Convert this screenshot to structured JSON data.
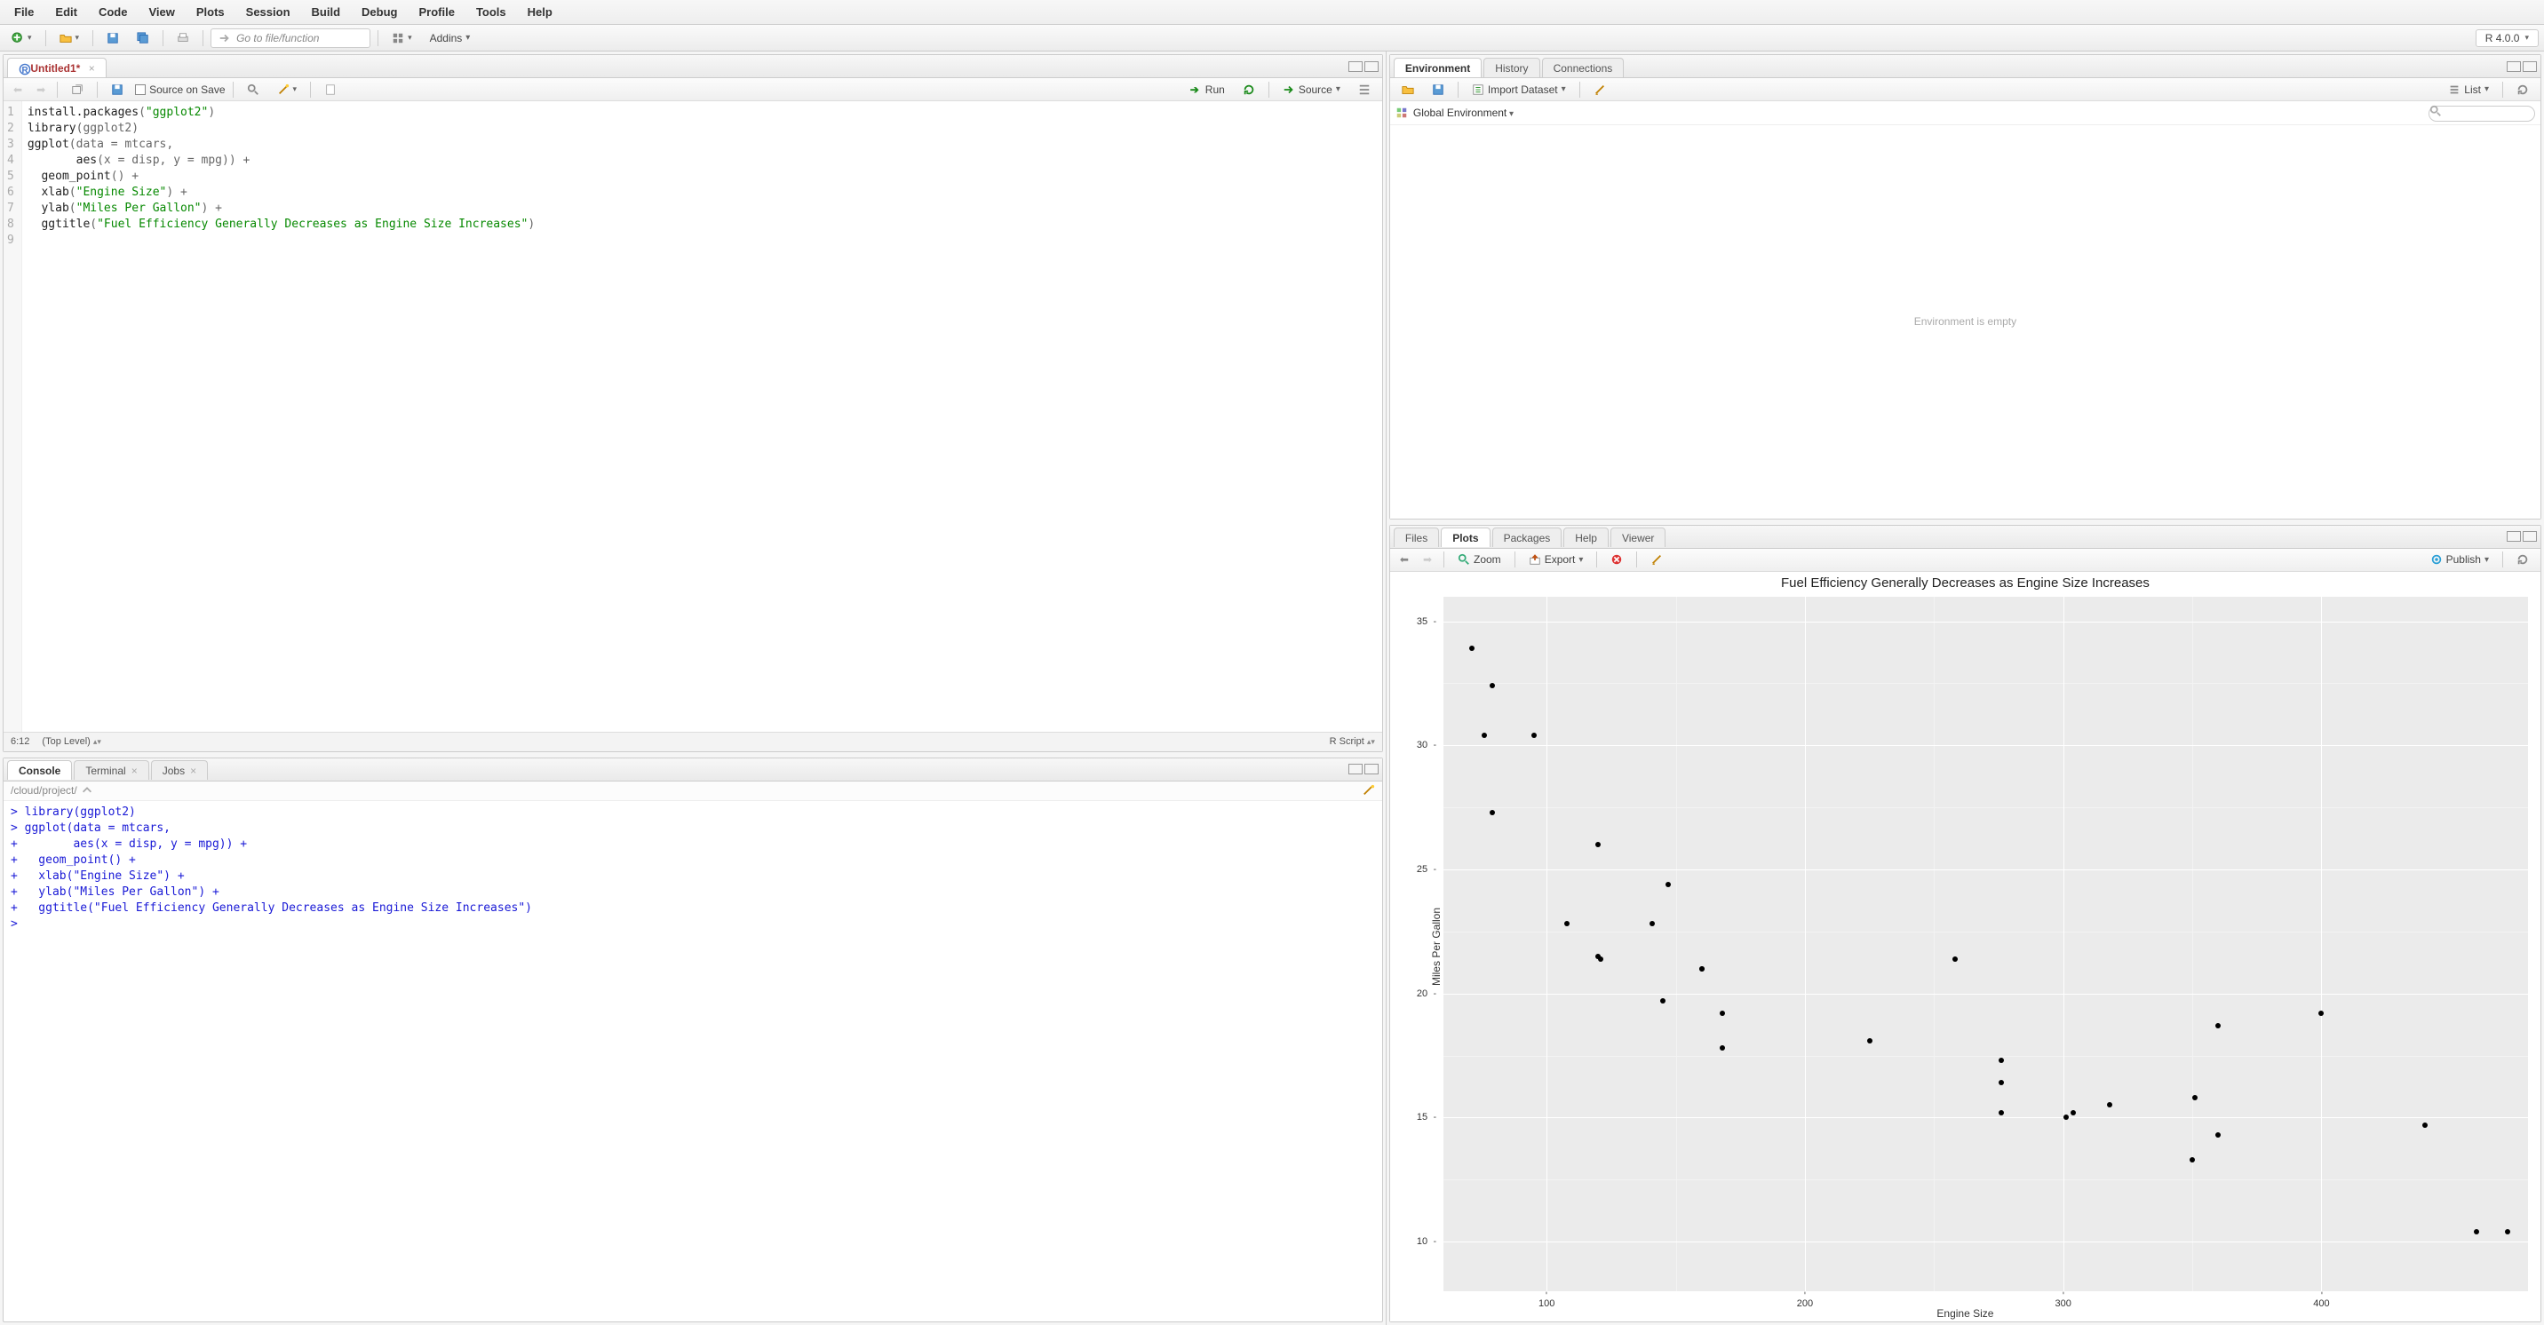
{
  "menus": [
    "File",
    "Edit",
    "Code",
    "View",
    "Plots",
    "Session",
    "Build",
    "Debug",
    "Profile",
    "Tools",
    "Help"
  ],
  "topbar": {
    "goto_placeholder": "Go to file/function",
    "addins_label": "Addins",
    "r_version": "R 4.0.0"
  },
  "source": {
    "tab_label": "Untitled1*",
    "save_on_source_label": "Source on Save",
    "run_label": "Run",
    "source_btn_label": "Source",
    "cursor_pos": "6:12",
    "scope_label": "(Top Level)",
    "lang_label": "R Script",
    "line_numbers": [
      "1",
      "2",
      "3",
      "4",
      "5",
      "6",
      "7",
      "8",
      "9"
    ],
    "code_lines": [
      [
        {
          "t": "install.packages",
          "c": "tk-fn"
        },
        {
          "t": "(",
          "c": "tk-op"
        },
        {
          "t": "\"ggplot2\"",
          "c": "tk-str"
        },
        {
          "t": ")",
          "c": "tk-op"
        }
      ],
      [
        {
          "t": "library",
          "c": "tk-fn"
        },
        {
          "t": "(ggplot2)",
          "c": "tk-op"
        }
      ],
      [
        {
          "t": "ggplot",
          "c": "tk-fn"
        },
        {
          "t": "(data = mtcars,",
          "c": "tk-op"
        }
      ],
      [
        {
          "t": "       aes",
          "c": "tk-fn"
        },
        {
          "t": "(x = disp, y = mpg)) +",
          "c": "tk-op"
        }
      ],
      [
        {
          "t": "  geom_point",
          "c": "tk-fn"
        },
        {
          "t": "() +",
          "c": "tk-op"
        }
      ],
      [
        {
          "t": "  xlab",
          "c": "tk-fn"
        },
        {
          "t": "(",
          "c": "tk-op"
        },
        {
          "t": "\"Engine Size\"",
          "c": "tk-str"
        },
        {
          "t": ") +",
          "c": "tk-op"
        }
      ],
      [
        {
          "t": "  ylab",
          "c": "tk-fn"
        },
        {
          "t": "(",
          "c": "tk-op"
        },
        {
          "t": "\"Miles Per Gallon\"",
          "c": "tk-str"
        },
        {
          "t": ") +",
          "c": "tk-op"
        }
      ],
      [
        {
          "t": "  ggtitle",
          "c": "tk-fn"
        },
        {
          "t": "(",
          "c": "tk-op"
        },
        {
          "t": "\"Fuel Efficiency Generally Decreases as Engine Size Increases\"",
          "c": "tk-str"
        },
        {
          "t": ")",
          "c": "tk-op"
        }
      ],
      [
        {
          "t": "",
          "c": ""
        }
      ]
    ]
  },
  "console": {
    "tabs": [
      "Console",
      "Terminal",
      "Jobs"
    ],
    "active_tab": 0,
    "path": "/cloud/project/",
    "lines": [
      "> library(ggplot2)",
      "> ggplot(data = mtcars,",
      "+        aes(x = disp, y = mpg)) +",
      "+   geom_point() +",
      "+   xlab(\"Engine Size\") +",
      "+   ylab(\"Miles Per Gallon\") +",
      "+   ggtitle(\"Fuel Efficiency Generally Decreases as Engine Size Increases\")",
      "> "
    ]
  },
  "environment": {
    "tabs": [
      "Environment",
      "History",
      "Connections"
    ],
    "active_tab": 0,
    "import_label": "Import Dataset",
    "list_label": "List",
    "scope_label": "Global Environment",
    "search_placeholder": "",
    "empty_msg": "Environment is empty"
  },
  "plots": {
    "tabs": [
      "Files",
      "Plots",
      "Packages",
      "Help",
      "Viewer"
    ],
    "active_tab": 1,
    "zoom_label": "Zoom",
    "export_label": "Export",
    "publish_label": "Publish"
  },
  "chart_data": {
    "type": "scatter",
    "title": "Fuel Efficiency Generally Decreases as Engine Size Increases",
    "xlabel": "Engine Size",
    "ylabel": "Miles Per Gallon",
    "xlim": [
      60,
      480
    ],
    "ylim": [
      8,
      36
    ],
    "xticks": [
      100,
      200,
      300,
      400
    ],
    "yticks": [
      10,
      15,
      20,
      25,
      30,
      35
    ],
    "points": [
      {
        "x": 160,
        "y": 21.0
      },
      {
        "x": 160,
        "y": 21.0
      },
      {
        "x": 108,
        "y": 22.8
      },
      {
        "x": 258,
        "y": 21.4
      },
      {
        "x": 360,
        "y": 18.7
      },
      {
        "x": 225,
        "y": 18.1
      },
      {
        "x": 360,
        "y": 14.3
      },
      {
        "x": 147,
        "y": 24.4
      },
      {
        "x": 141,
        "y": 22.8
      },
      {
        "x": 168,
        "y": 19.2
      },
      {
        "x": 168,
        "y": 17.8
      },
      {
        "x": 276,
        "y": 16.4
      },
      {
        "x": 276,
        "y": 17.3
      },
      {
        "x": 276,
        "y": 15.2
      },
      {
        "x": 472,
        "y": 10.4
      },
      {
        "x": 460,
        "y": 10.4
      },
      {
        "x": 440,
        "y": 14.7
      },
      {
        "x": 79,
        "y": 32.4
      },
      {
        "x": 76,
        "y": 30.4
      },
      {
        "x": 71,
        "y": 33.9
      },
      {
        "x": 120,
        "y": 21.5
      },
      {
        "x": 318,
        "y": 15.5
      },
      {
        "x": 304,
        "y": 15.2
      },
      {
        "x": 350,
        "y": 13.3
      },
      {
        "x": 400,
        "y": 19.2
      },
      {
        "x": 79,
        "y": 27.3
      },
      {
        "x": 120,
        "y": 26.0
      },
      {
        "x": 95,
        "y": 30.4
      },
      {
        "x": 351,
        "y": 15.8
      },
      {
        "x": 145,
        "y": 19.7
      },
      {
        "x": 301,
        "y": 15.0
      },
      {
        "x": 121,
        "y": 21.4
      }
    ]
  }
}
